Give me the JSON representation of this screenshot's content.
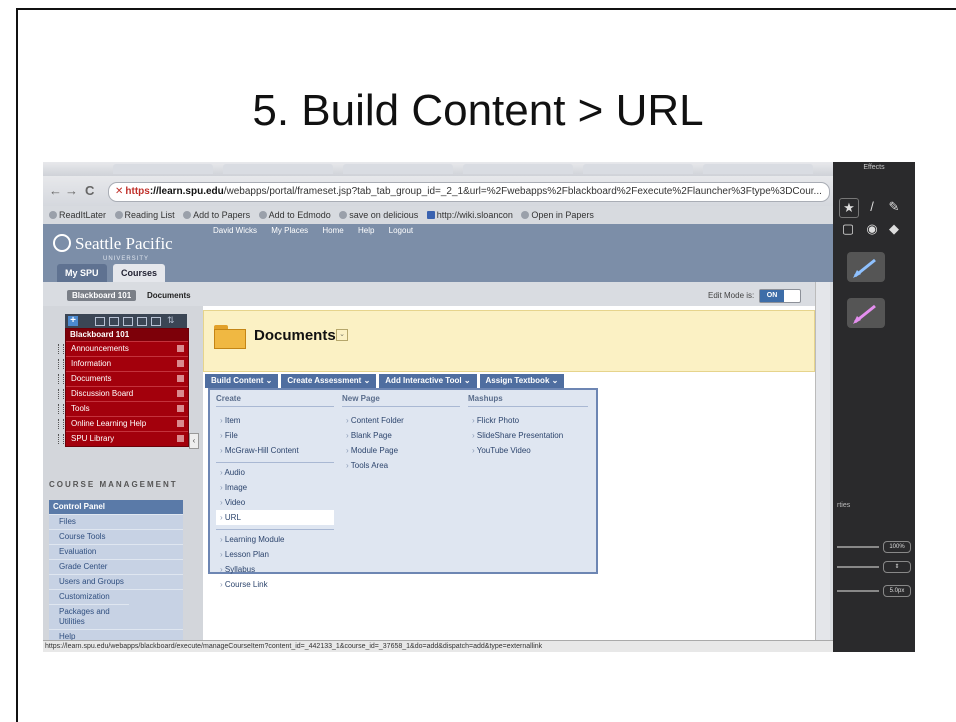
{
  "slide": {
    "title": "5. Build Content > URL"
  },
  "browser": {
    "nav_back": "←",
    "nav_forward": "→",
    "nav_reload": "C",
    "url_https": "https",
    "url_host": "://learn.spu.edu",
    "url_rest": "/webapps/portal/frameset.jsp?tab_tab_group_id=_2_1&url=%2Fwebapps%2Fblackboard%2Fexecute%2Flauncher%3Ftype%3DCour...",
    "bookmarks": [
      "ReadItLater",
      "Reading List",
      "Add to Papers",
      "Add to Edmodo",
      "save on delicious",
      "http://wiki.sloancon",
      "Open in Papers"
    ],
    "status_url": "https://learn.spu.edu/webapps/blackboard/execute/manageCourseItem?content_id=_442133_1&course_id=_37658_1&do=add&dispatch=add&type=externallink"
  },
  "header": {
    "logo": "Seattle Pacific",
    "logo_sub": "UNIVERSITY",
    "user": "David Wicks",
    "my_places": "My Places",
    "home": "Home",
    "help": "Help",
    "logout": "Logout",
    "tab_myspu": "My SPU",
    "tab_courses": "Courses"
  },
  "breadcrumb": {
    "course": "Blackboard 101",
    "page": "Documents"
  },
  "edit_mode": {
    "label": "Edit Mode is:",
    "value": "ON"
  },
  "course_menu": {
    "title": "Blackboard 101",
    "items": [
      "Announcements",
      "Information",
      "Documents",
      "Discussion Board",
      "Tools",
      "Online Learning Help",
      "SPU Library"
    ]
  },
  "course_management": {
    "title": "COURSE MANAGEMENT",
    "control_panel": "Control Panel",
    "items": [
      "Files",
      "Course Tools",
      "Evaluation",
      "Grade Center",
      "Users and Groups",
      "Customization",
      "Packages and Utilities",
      "Help"
    ]
  },
  "page": {
    "title": "Documents"
  },
  "actions": [
    "Build Content",
    "Create Assessment",
    "Add Interactive Tool",
    "Assign Textbook"
  ],
  "dropdown": {
    "create_header": "Create",
    "create_items": [
      "Item",
      "File",
      "McGraw-Hill Content"
    ],
    "create_items2": [
      "Audio",
      "Image",
      "Video",
      "URL"
    ],
    "create_items3": [
      "Learning Module",
      "Lesson Plan",
      "Syllabus",
      "Course Link"
    ],
    "newpage_header": "New Page",
    "newpage_items": [
      "Content Folder",
      "Blank Page",
      "Module Page",
      "Tools Area"
    ],
    "mashups_header": "Mashups",
    "mashups_items": [
      "Flickr Photo",
      "SlideShare Presentation",
      "YouTube Video"
    ]
  },
  "side_panel": {
    "title": "Effects",
    "label": "rties",
    "val1": "100%",
    "val2": "5.0px"
  }
}
